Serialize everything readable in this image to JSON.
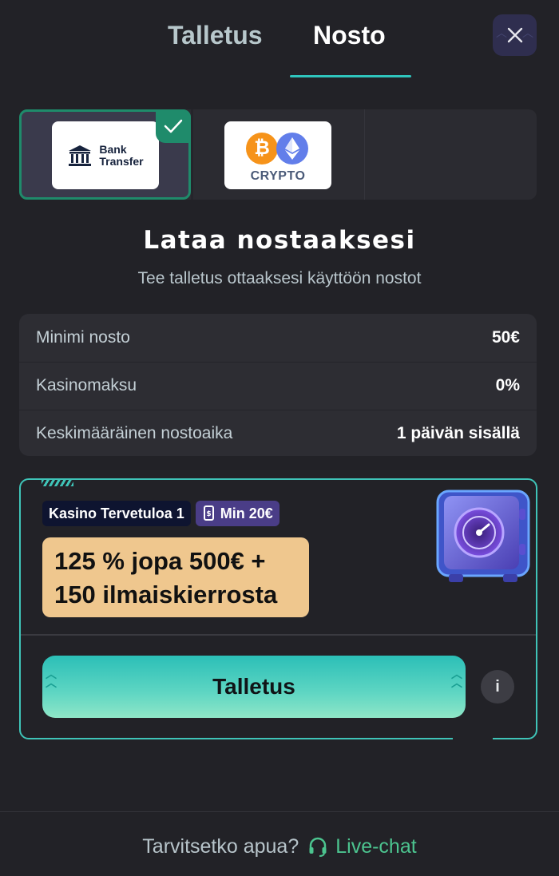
{
  "header": {
    "tabs": [
      {
        "label": "Talletus",
        "active": false
      },
      {
        "label": "Nosto",
        "active": true
      }
    ],
    "close_icon": "close-icon"
  },
  "payment_methods": [
    {
      "name": "Bank Transfer",
      "label_line1": "Bank",
      "label_line2": "Transfer",
      "selected": true,
      "icon": "bank-icon"
    },
    {
      "name": "Crypto",
      "label": "CRYPTO",
      "btc_symbol": "₿",
      "selected": false,
      "icon": "crypto-icon"
    }
  ],
  "heading": "Lataa nostaaksesi",
  "subheading": "Tee talletus ottaaksesi käyttöön nostot",
  "info_rows": [
    {
      "label": "Minimi nosto",
      "value": "50€"
    },
    {
      "label": "Kasinomaksu",
      "value": "0%"
    },
    {
      "label": "Keskimääräinen nostoaika",
      "value": "1 päivän sisällä"
    }
  ],
  "bonus": {
    "tag_name": "Kasino Tervetuloa 1",
    "tag_min": "Min 20€",
    "offer_line1": "125 % jopa 500€ +",
    "offer_line2": "150 ilmaiskierrosta",
    "deposit_button": "Talletus",
    "info_button": "i"
  },
  "footer": {
    "help_text": "Tarvitsetko apua?",
    "chat_label": "Live-chat"
  },
  "colors": {
    "background": "#222227",
    "accent_teal": "#2fc5bd",
    "selected_green": "#1f8b6b",
    "offer_bg": "#efc78e",
    "chat_green": "#4cc48f"
  }
}
